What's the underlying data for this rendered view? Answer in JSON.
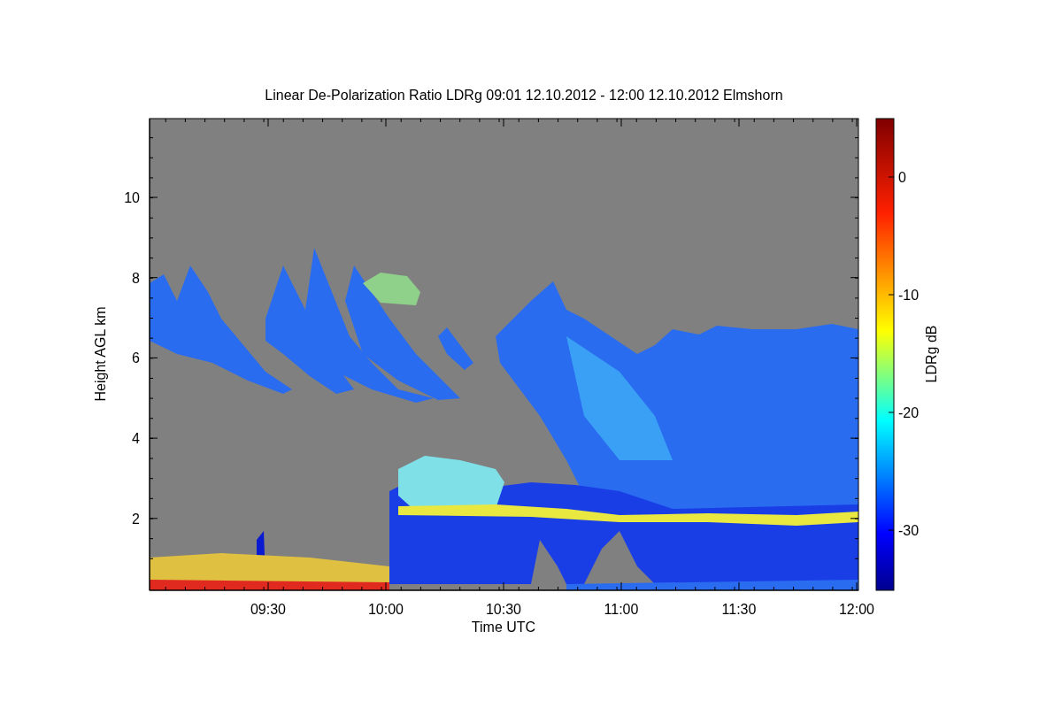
{
  "title": "Linear De-Polarization Ratio LDRg   09:01 12.10.2012 - 12:00 12.10.2012 Elmshorn",
  "x_axis": {
    "label": "Time UTC",
    "ticks": [
      "09:30",
      "10:00",
      "10:30",
      "11:00",
      "11:30",
      "12:00"
    ]
  },
  "y_axis": {
    "label": "Height AGL km",
    "ticks": [
      "10",
      "8",
      "6",
      "4",
      "2"
    ]
  },
  "colorbar": {
    "label": "LDRg dB",
    "ticks": [
      "0",
      "-10",
      "-20",
      "-30"
    ]
  }
}
